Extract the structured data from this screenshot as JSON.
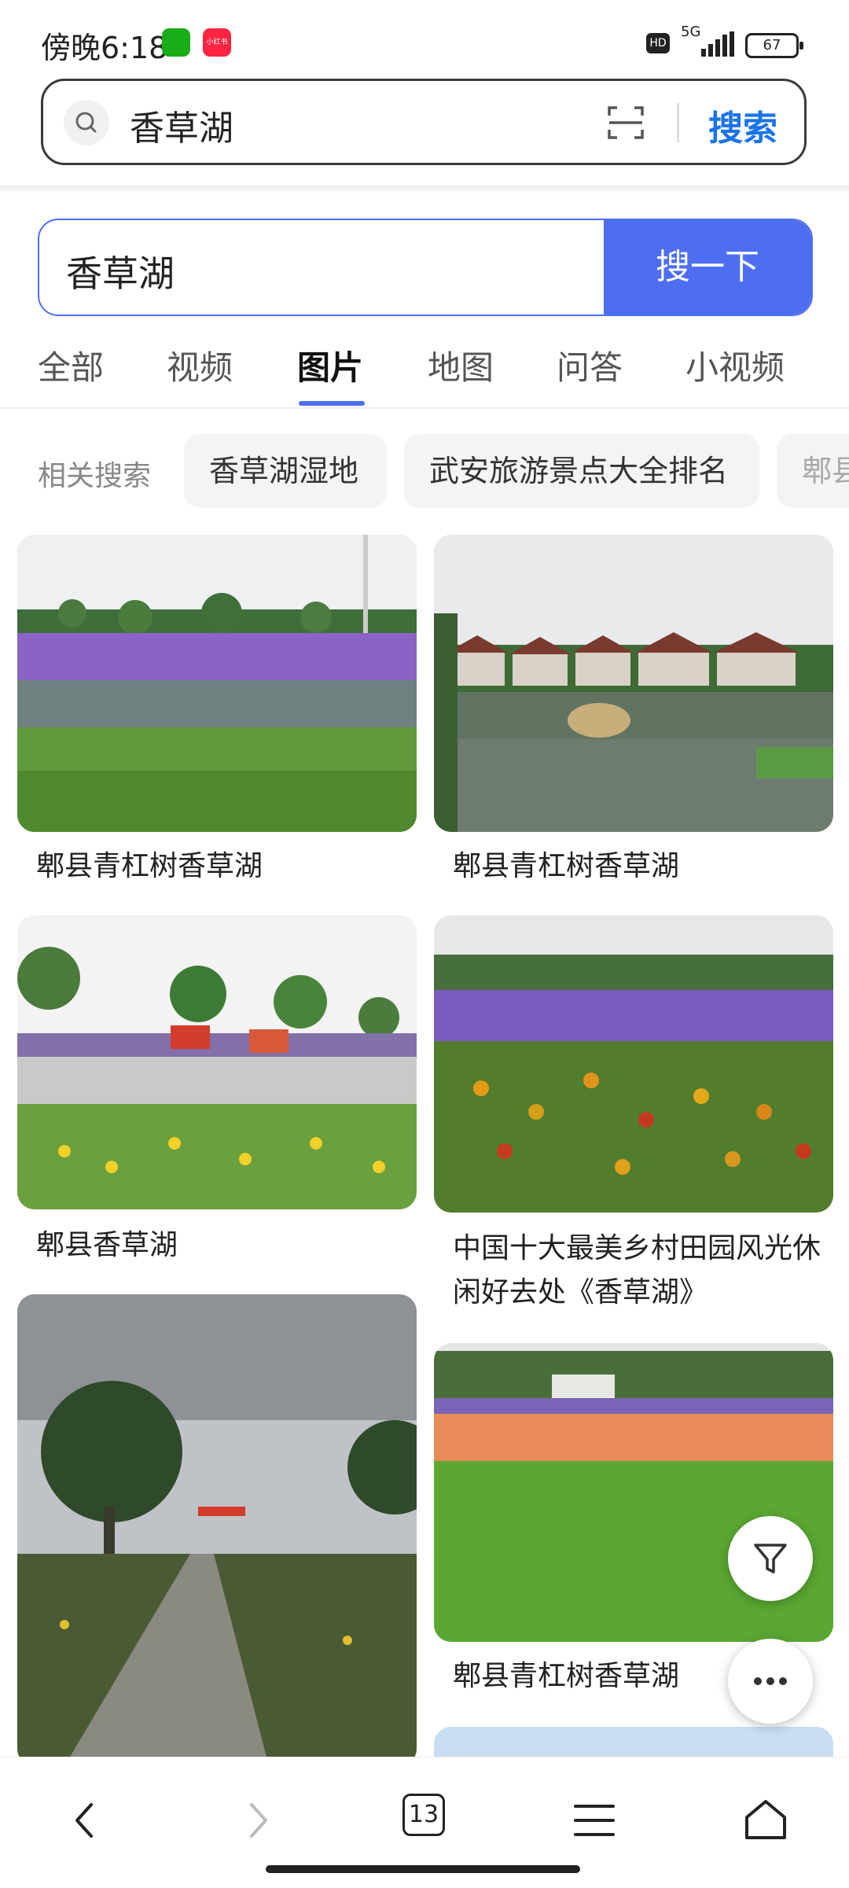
{
  "status_bar": {
    "time": "傍晚6:18",
    "network": "5G",
    "battery": "67",
    "hd_label": "HD",
    "xhs_label": "小红书"
  },
  "address_bar": {
    "query": "香草湖",
    "search_label": "搜索"
  },
  "search": {
    "value": "香草湖",
    "button": "搜一下"
  },
  "tabs": [
    {
      "label": "全部"
    },
    {
      "label": "视频"
    },
    {
      "label": "图片",
      "active": true
    },
    {
      "label": "地图"
    },
    {
      "label": "问答"
    },
    {
      "label": "小视频"
    }
  ],
  "related": {
    "label": "相关搜索",
    "items": [
      "香草湖湿地",
      "武安旅游景点大全排名",
      "郫县"
    ]
  },
  "images": [
    {
      "caption": "郫县青杠树香草湖",
      "scene": "purple-flower-field"
    },
    {
      "caption": "郫县青杠树香草湖",
      "scene": "lake-villas"
    },
    {
      "caption": "郫县香草湖",
      "scene": "road-bikes-flowers"
    },
    {
      "caption": "中国十大最美乡村田园风光休闲好去处《香草湖》",
      "scene": "orange-purple-flowers"
    },
    {
      "caption": "",
      "scene": "garden-path"
    },
    {
      "caption": "郫县青杠树香草湖",
      "scene": "lawn-flower-bed"
    }
  ],
  "bottom_nav": {
    "tab_count": "13"
  },
  "colors": {
    "accent": "#4e6ef2",
    "link_blue": "#1a73e8"
  },
  "icons": [
    "search-icon",
    "scan-icon",
    "filter-icon",
    "more-icon",
    "back-icon",
    "forward-icon",
    "tabs-icon",
    "menu-icon",
    "home-icon"
  ]
}
